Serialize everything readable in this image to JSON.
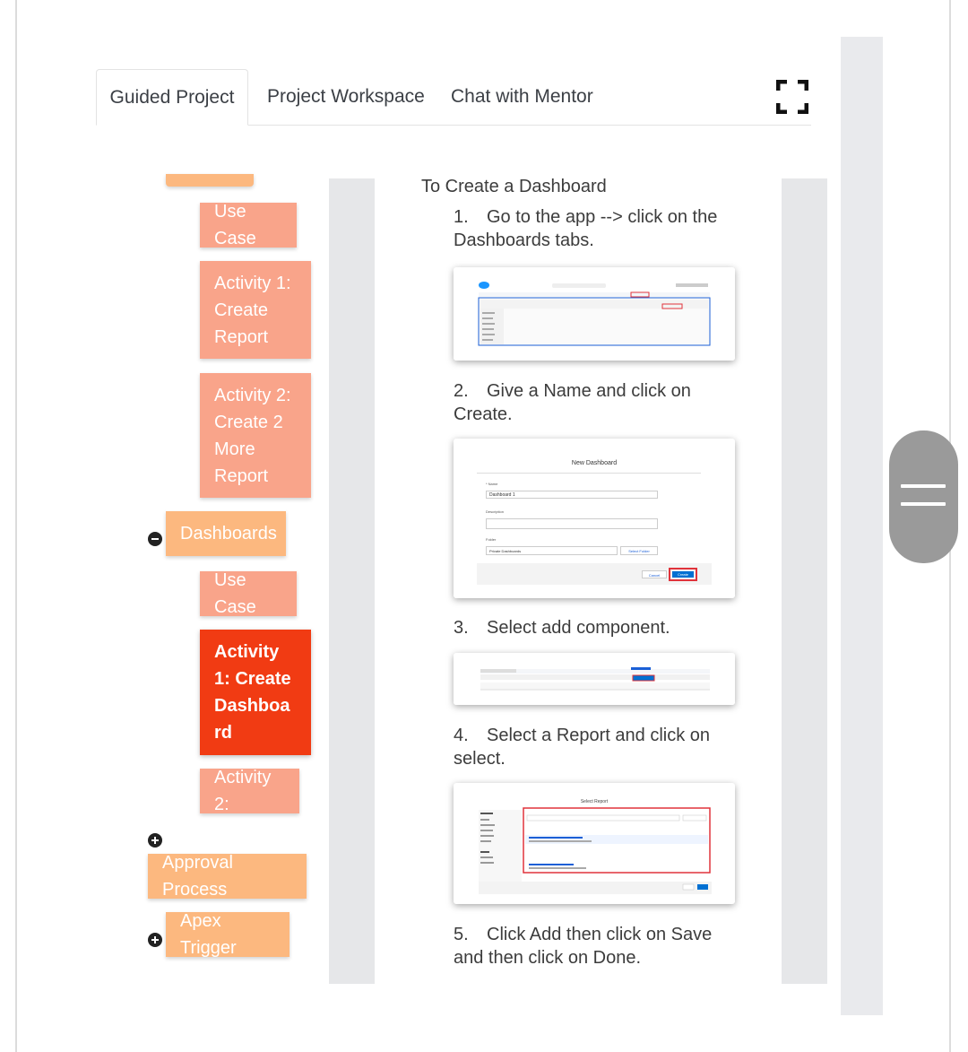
{
  "tabs": [
    {
      "label": "Guided Project"
    },
    {
      "label": "Project Workspace"
    },
    {
      "label": "Chat with Mentor"
    }
  ],
  "icons": {
    "fullscreen": "fullscreen-icon",
    "collapse": "minus-circle-icon",
    "expand": "plus-circle-icon",
    "scroll_handle": "drag-handle-icon"
  },
  "colors": {
    "nav_light": "#f9a48a",
    "nav_section": "#fcb87f",
    "nav_active": "#f13b13",
    "accent_blue": "#0070d2",
    "highlight_red": "#e0333b"
  },
  "sidebar": {
    "items": [
      {
        "label": "Use Case"
      },
      {
        "label": "Activity 1: Create Report"
      },
      {
        "label": "Activity 2: Create 2 More Report"
      },
      {
        "label": "Dashboards"
      },
      {
        "label": "Use Case"
      },
      {
        "label": "Activity 1: Create Dashboard"
      },
      {
        "label": "Activity 2:"
      },
      {
        "label": "Approval Process"
      },
      {
        "label": "Apex Trigger"
      }
    ]
  },
  "content": {
    "title": "To Create a Dashboard",
    "steps": [
      {
        "num": "1.",
        "text": "Go to the app --> click on the Dashboards tabs."
      },
      {
        "num": "2.",
        "text": "Give a Name and click on Create."
      },
      {
        "num": "3.",
        "text": "Select add component."
      },
      {
        "num": "4.",
        "text": "Select a Report and click on select."
      },
      {
        "num": "5.",
        "text": "Click Add then click on Save and then click on Done."
      }
    ],
    "dialog_new_dashboard": {
      "title": "New Dashboard",
      "name_label": "* Name",
      "name_value": "Dashboard 1",
      "description_label": "Description",
      "folder_label": "Folder",
      "folder_value": "Private Dashboards",
      "select_folder_button": "Select Folder",
      "cancel_button": "Cancel",
      "create_button": "Create"
    },
    "dialog_select_report": {
      "title": "Select Report"
    }
  }
}
